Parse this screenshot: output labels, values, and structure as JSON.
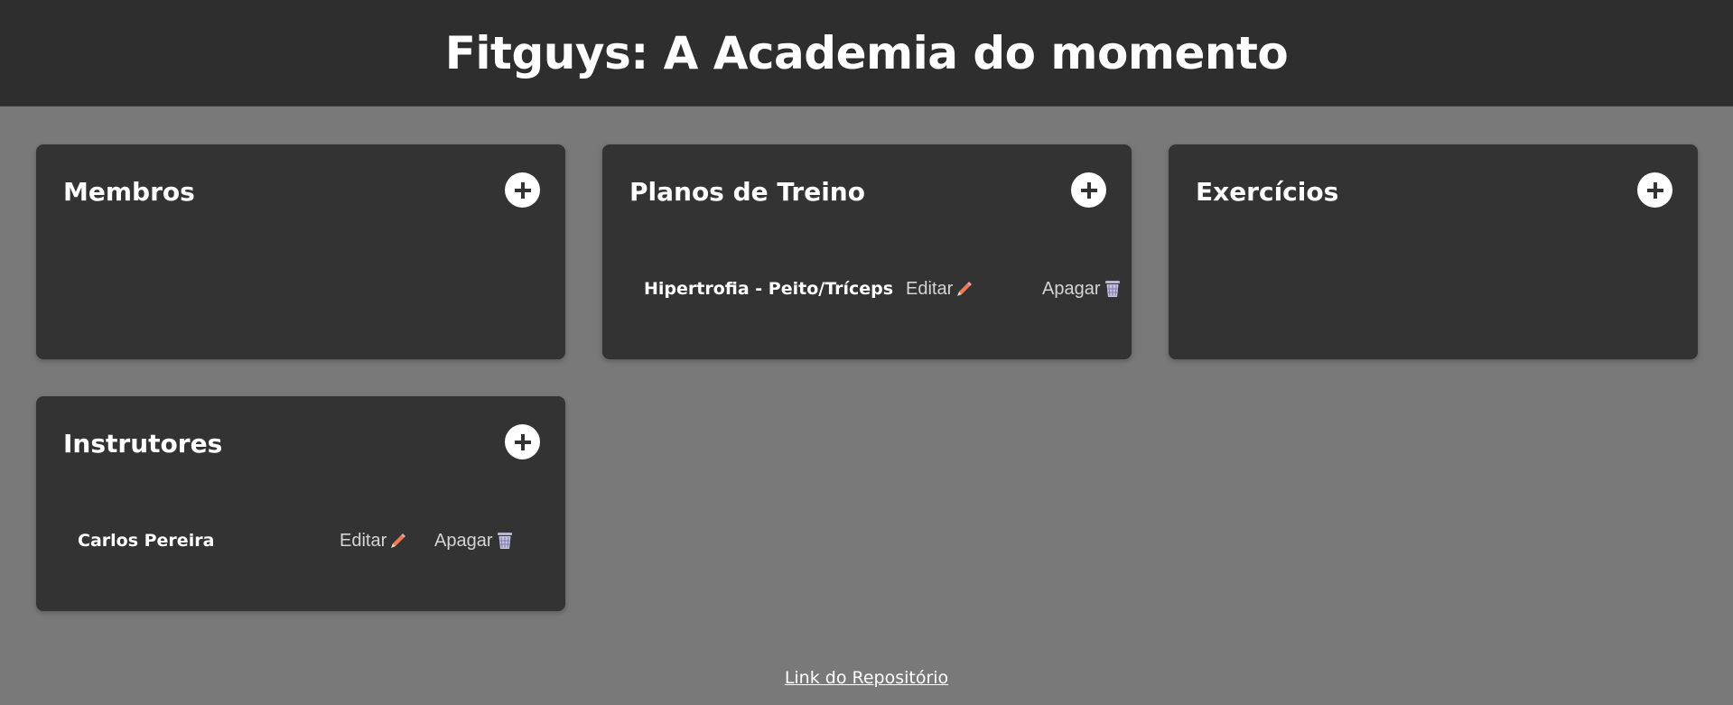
{
  "header": {
    "title": "Fitguys: A Academia do momento"
  },
  "cards": {
    "membros": {
      "title": "Membros",
      "add_icon": "plus-icon"
    },
    "planos": {
      "title": "Planos de Treino",
      "add_icon": "plus-icon",
      "items": [
        {
          "name": "Hipertrofia - Peito/Tríceps",
          "edit_label": "Editar",
          "delete_label": "Apagar"
        }
      ]
    },
    "exercicios": {
      "title": "Exercícios",
      "add_icon": "plus-icon"
    },
    "instrutores": {
      "title": "Instrutores",
      "add_icon": "plus-icon",
      "items": [
        {
          "name": "Carlos Pereira",
          "edit_label": "Editar",
          "delete_label": "Apagar"
        }
      ]
    }
  },
  "icons": {
    "edit": "pencil-icon",
    "delete": "wastebasket-icon"
  },
  "footer": {
    "repo_link": "Link do Repositório"
  },
  "colors": {
    "background": "#797979",
    "header": "#2e2e2e",
    "card": "#333333",
    "pencil": "#f07a52"
  }
}
